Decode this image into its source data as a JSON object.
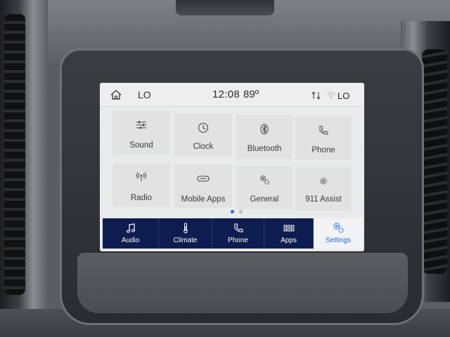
{
  "status_bar": {
    "left_label": "LO",
    "time": "12:08",
    "temperature": "89º",
    "right_label": "LO"
  },
  "settings_grid": [
    {
      "label": "Sound",
      "icon": "sliders-icon"
    },
    {
      "label": "Clock",
      "icon": "clock-icon"
    },
    {
      "label": "Bluetooth",
      "icon": "bluetooth-icon"
    },
    {
      "label": "Phone",
      "icon": "phone-icon"
    },
    {
      "label": "Radio",
      "icon": "radio-antenna-icon"
    },
    {
      "label": "Mobile Apps",
      "icon": "mobile-apps-icon"
    },
    {
      "label": "General",
      "icon": "gears-icon"
    },
    {
      "label": "911 Assist",
      "icon": "assist-icon"
    }
  ],
  "pagination": {
    "pages": 2,
    "current": 1
  },
  "nav_bar": {
    "items": [
      {
        "label": "Audio",
        "icon": "music-note-icon"
      },
      {
        "label": "Climate",
        "icon": "thermometer-icon"
      },
      {
        "label": "Phone",
        "icon": "phone-icon"
      },
      {
        "label": "Apps",
        "icon": "apps-grid-icon"
      },
      {
        "label": "Settings",
        "icon": "settings-gears-icon"
      }
    ],
    "active": "Settings"
  },
  "colors": {
    "nav_background": "#0e1d4f",
    "active_accent": "#2c6bd6",
    "screen_background": "#e9eaea"
  }
}
